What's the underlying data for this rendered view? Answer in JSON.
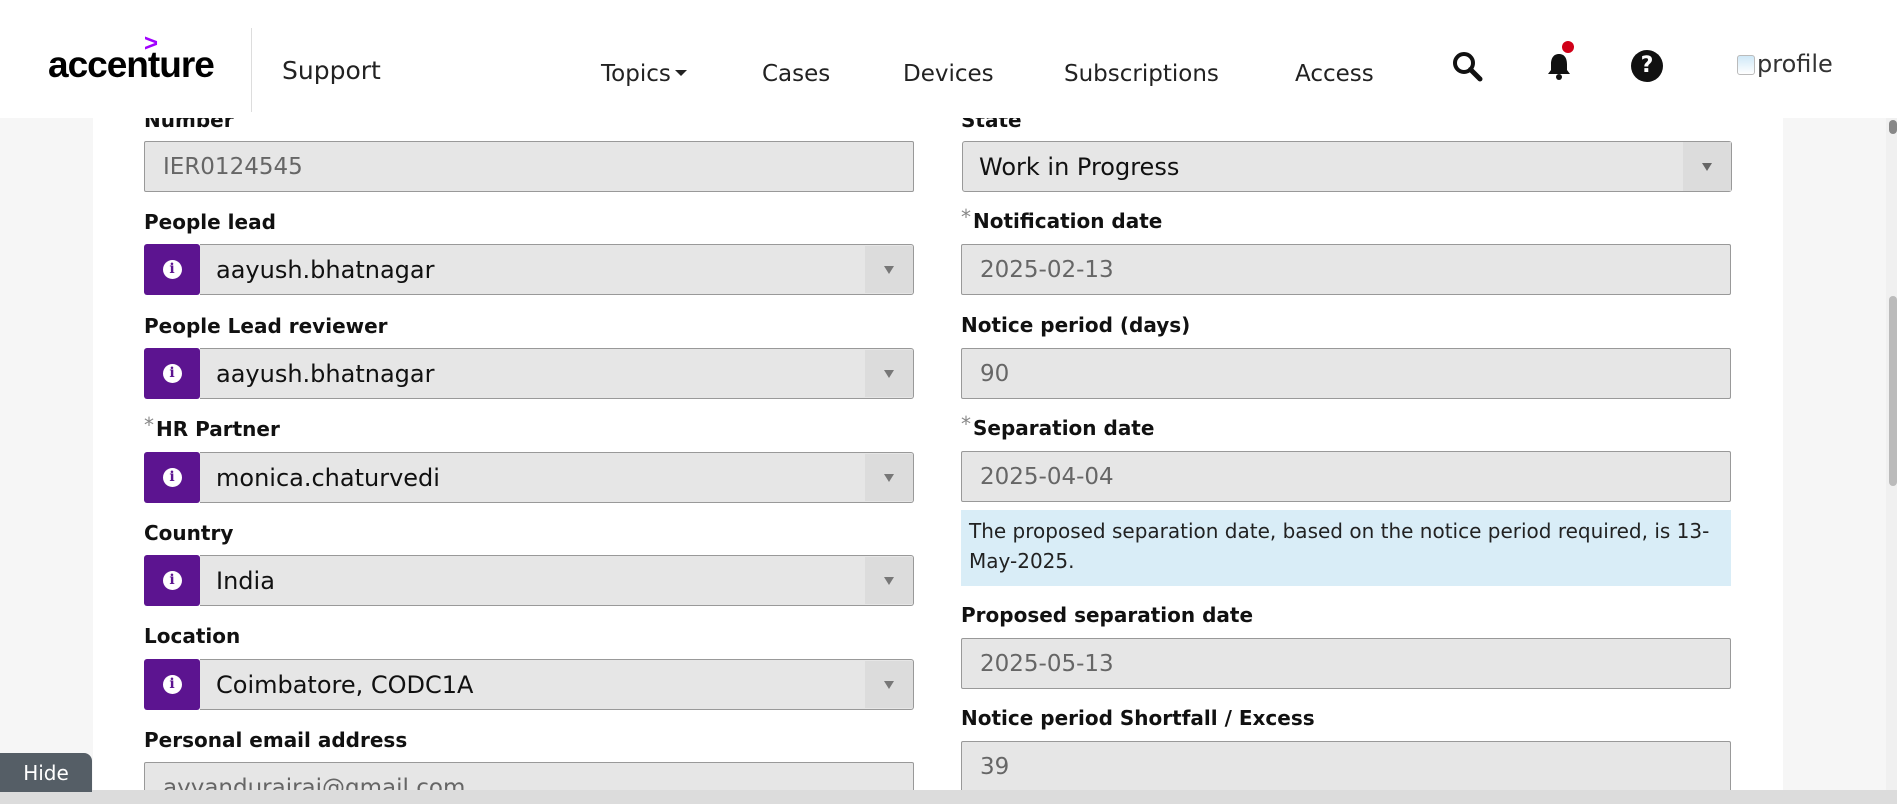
{
  "header": {
    "logo_text": "accenture",
    "logo_mark": ">",
    "subtitle": "Support",
    "nav": {
      "topics": "Topics",
      "cases": "Cases",
      "devices": "Devices",
      "subscriptions": "Subscriptions",
      "access": "Access"
    },
    "icons": [
      "search-icon",
      "bell-icon",
      "help-icon"
    ],
    "help_glyph": "?",
    "profile_alt": "profile",
    "notification_dot_color": "#d00018"
  },
  "form": {
    "left": {
      "number": {
        "label": "Number",
        "value": "IER0124545"
      },
      "people_lead": {
        "label": "People lead",
        "value": "aayush.bhatnagar"
      },
      "people_lead_reviewer": {
        "label": "People Lead reviewer",
        "value": "aayush.bhatnagar"
      },
      "hr_partner": {
        "label": "HR Partner",
        "required_mark": "*",
        "value": "monica.chaturvedi"
      },
      "country": {
        "label": "Country",
        "value": "India"
      },
      "location": {
        "label": "Location",
        "value": "Coimbatore, CODC1A"
      },
      "personal_email": {
        "label": "Personal email address",
        "value": "ayyandurairaj@gmail.com"
      }
    },
    "right": {
      "state": {
        "label": "State",
        "value": "Work in Progress"
      },
      "notification_date": {
        "label": "Notification date",
        "required_mark": "*",
        "value": "2025-02-13"
      },
      "notice_period": {
        "label": "Notice period (days)",
        "value": "90"
      },
      "separation_date": {
        "label": "Separation date",
        "required_mark": "*",
        "value": "2025-04-04"
      },
      "separation_note": "The proposed separation date, based on the notice period required, is 13-May-2025.",
      "proposed_separation_date": {
        "label": "Proposed separation date",
        "value": "2025-05-13"
      },
      "shortfall_excess": {
        "label": "Notice period Shortfall / Excess",
        "value": "39"
      }
    },
    "info_glyph": "i",
    "accent_color": "#5c1490"
  },
  "hide_button": "Hide"
}
